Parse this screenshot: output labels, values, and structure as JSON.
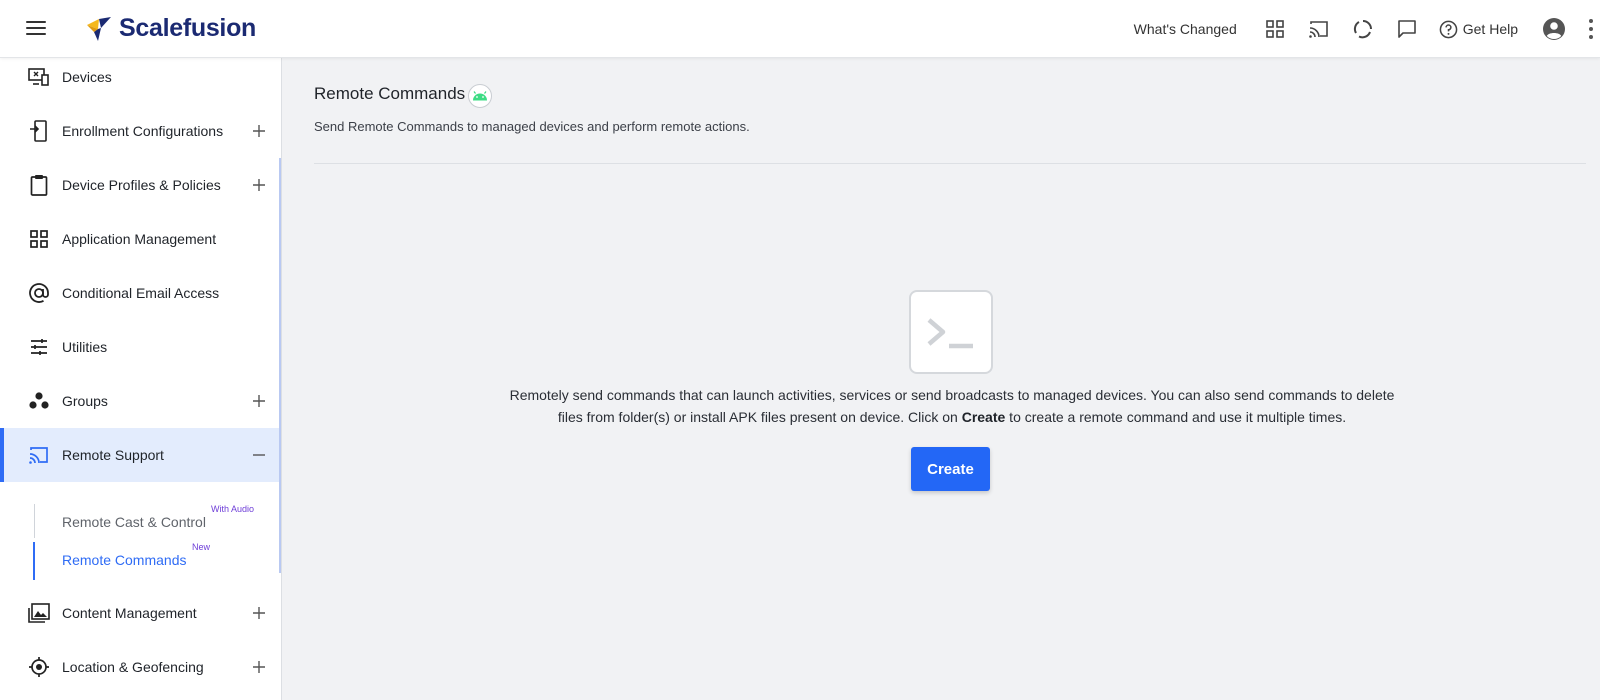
{
  "header": {
    "brand": "Scalefusion",
    "whats_changed": "What's Changed",
    "get_help": "Get Help"
  },
  "sidebar": {
    "items": [
      {
        "label": "Devices",
        "icon": "devices-icon"
      },
      {
        "label": "Enrollment Configurations",
        "icon": "enrollment-icon"
      },
      {
        "label": "Device Profiles & Policies",
        "icon": "clipboard-icon"
      },
      {
        "label": "Application Management",
        "icon": "apps-grid-icon"
      },
      {
        "label": "Conditional Email Access",
        "icon": "at-sign-icon"
      },
      {
        "label": "Utilities",
        "icon": "sliders-icon"
      },
      {
        "label": "Groups",
        "icon": "groups-icon"
      },
      {
        "label": "Remote Support",
        "icon": "cast-icon"
      },
      {
        "label": "Content Management",
        "icon": "image-library-icon"
      },
      {
        "label": "Location & Geofencing",
        "icon": "crosshair-icon"
      }
    ],
    "remote_support_sub": [
      {
        "label": "Remote Cast & Control",
        "badge": "With Audio"
      },
      {
        "label": "Remote Commands",
        "badge": "New"
      }
    ]
  },
  "main": {
    "title": "Remote Commands",
    "subtitle": "Send Remote Commands to managed devices and perform remote actions.",
    "empty_line1": "Remotely send commands that can launch activities, services or send broadcasts to managed devices. You can also send commands to delete",
    "empty_line2_pre": "files from folder(s) or install APK files present on device. Click on ",
    "empty_line2_bold": "Create",
    "empty_line2_post": " to create a remote command and use it multiple times.",
    "create_label": "Create"
  },
  "colors": {
    "accent": "#2f6cf5",
    "brand_navy": "#1b2a72",
    "brand_gold": "#f5b81c",
    "active_bg": "#e3ecfd",
    "android_green": "#3ddc84",
    "badge_purple": "#6f3fd8"
  }
}
